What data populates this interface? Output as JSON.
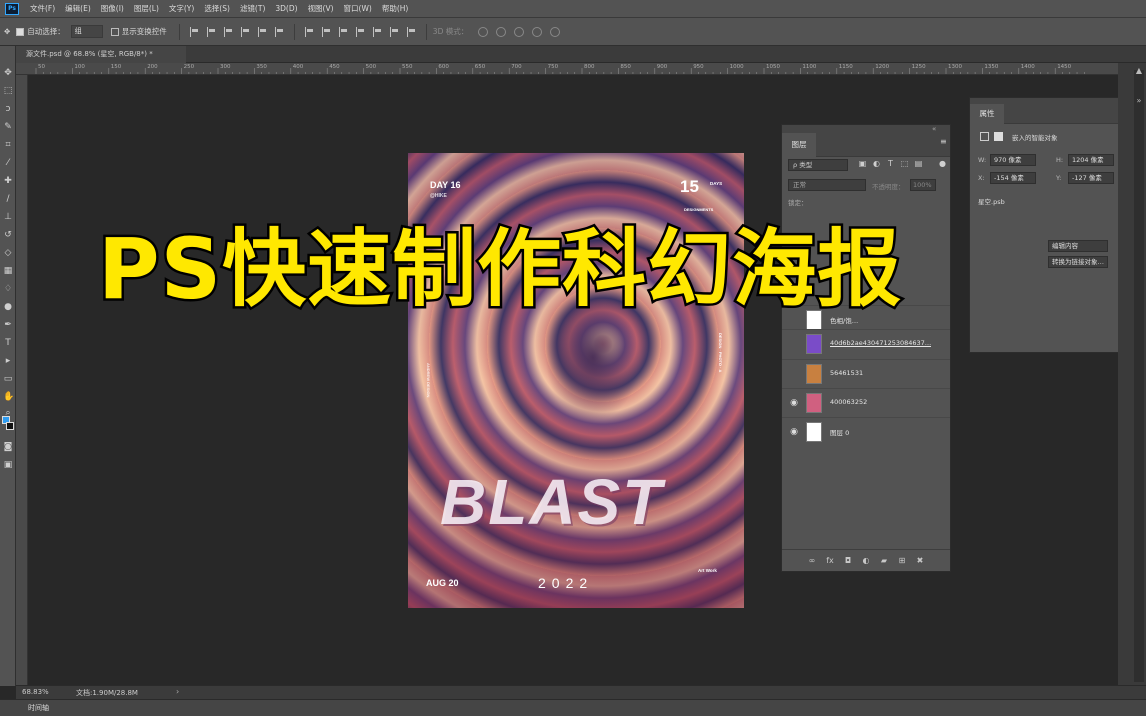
{
  "app": {
    "logo": "Ps",
    "menu": [
      "文件(F)",
      "编辑(E)",
      "图像(I)",
      "图层(L)",
      "文字(Y)",
      "选择(S)",
      "滤镜(T)",
      "3D(D)",
      "视图(V)",
      "窗口(W)",
      "帮助(H)"
    ]
  },
  "options": {
    "auto_select_label": "自动选择：",
    "auto_select_value": "组",
    "show_transform": "显示变换控件",
    "mode_3d": "3D 模式："
  },
  "document": {
    "tab_title": "源文件.psd @ 68.8% (星空, RGB/8*) *"
  },
  "ruler": {
    "ticks": [
      "50",
      "100",
      "150",
      "200",
      "250",
      "300",
      "350",
      "400",
      "450",
      "500",
      "550",
      "600",
      "650",
      "700",
      "750",
      "800",
      "850",
      "900",
      "950",
      "1000",
      "1050",
      "1100",
      "1150",
      "1200",
      "1250",
      "1300",
      "1350",
      "1400",
      "1450"
    ]
  },
  "poster": {
    "day": "DAY 16",
    "hike": "@HIKE",
    "number": "15",
    "days": "DAYS",
    "sub": "DESIGNMENTS",
    "side_left": "ANDREW DESIGN",
    "side_right": "DESIGN · PHOTO · A",
    "blast": "BLAST",
    "date": "AUG 20",
    "year": "2022",
    "artwork": "Art Work"
  },
  "layers": {
    "tab": "图层",
    "filter": "ρ 类型",
    "blend_mode": "正常",
    "opacity_label": "不透明度：",
    "opacity_value": "100%",
    "lock_label": "锁定：",
    "items": [
      {
        "name": "色相/饱…",
        "visible": false,
        "thumb": "#ffffff"
      },
      {
        "name": "40d6b2ae430471253084637…",
        "visible": false,
        "thumb": "#7a4cc8"
      },
      {
        "name": "56461531",
        "visible": false,
        "thumb": "#c88040"
      },
      {
        "name": "400063252",
        "visible": true,
        "thumb": "#d06080"
      },
      {
        "name": "图层 0",
        "visible": true,
        "thumb": "#ffffff"
      }
    ]
  },
  "properties": {
    "tab": "属性",
    "subtitle": "嵌入的智能对象",
    "w_label": "W:",
    "w_value": "970 像素",
    "h_label": "H:",
    "h_value": "1204 像素",
    "x_label": "X:",
    "x_value": "-154 像素",
    "y_label": "Y:",
    "y_value": "-127 像素",
    "file": "星空.psb",
    "btn_edit": "编辑内容",
    "btn_convert": "转换为链接对象…"
  },
  "status": {
    "zoom": "68.83%",
    "doc_size": "文档:1.90M/28.8M",
    "arrow": "›",
    "timeline": "时间轴"
  },
  "overlay": {
    "title": "PS快速制作科幻海报",
    "color": "#ffe800"
  }
}
